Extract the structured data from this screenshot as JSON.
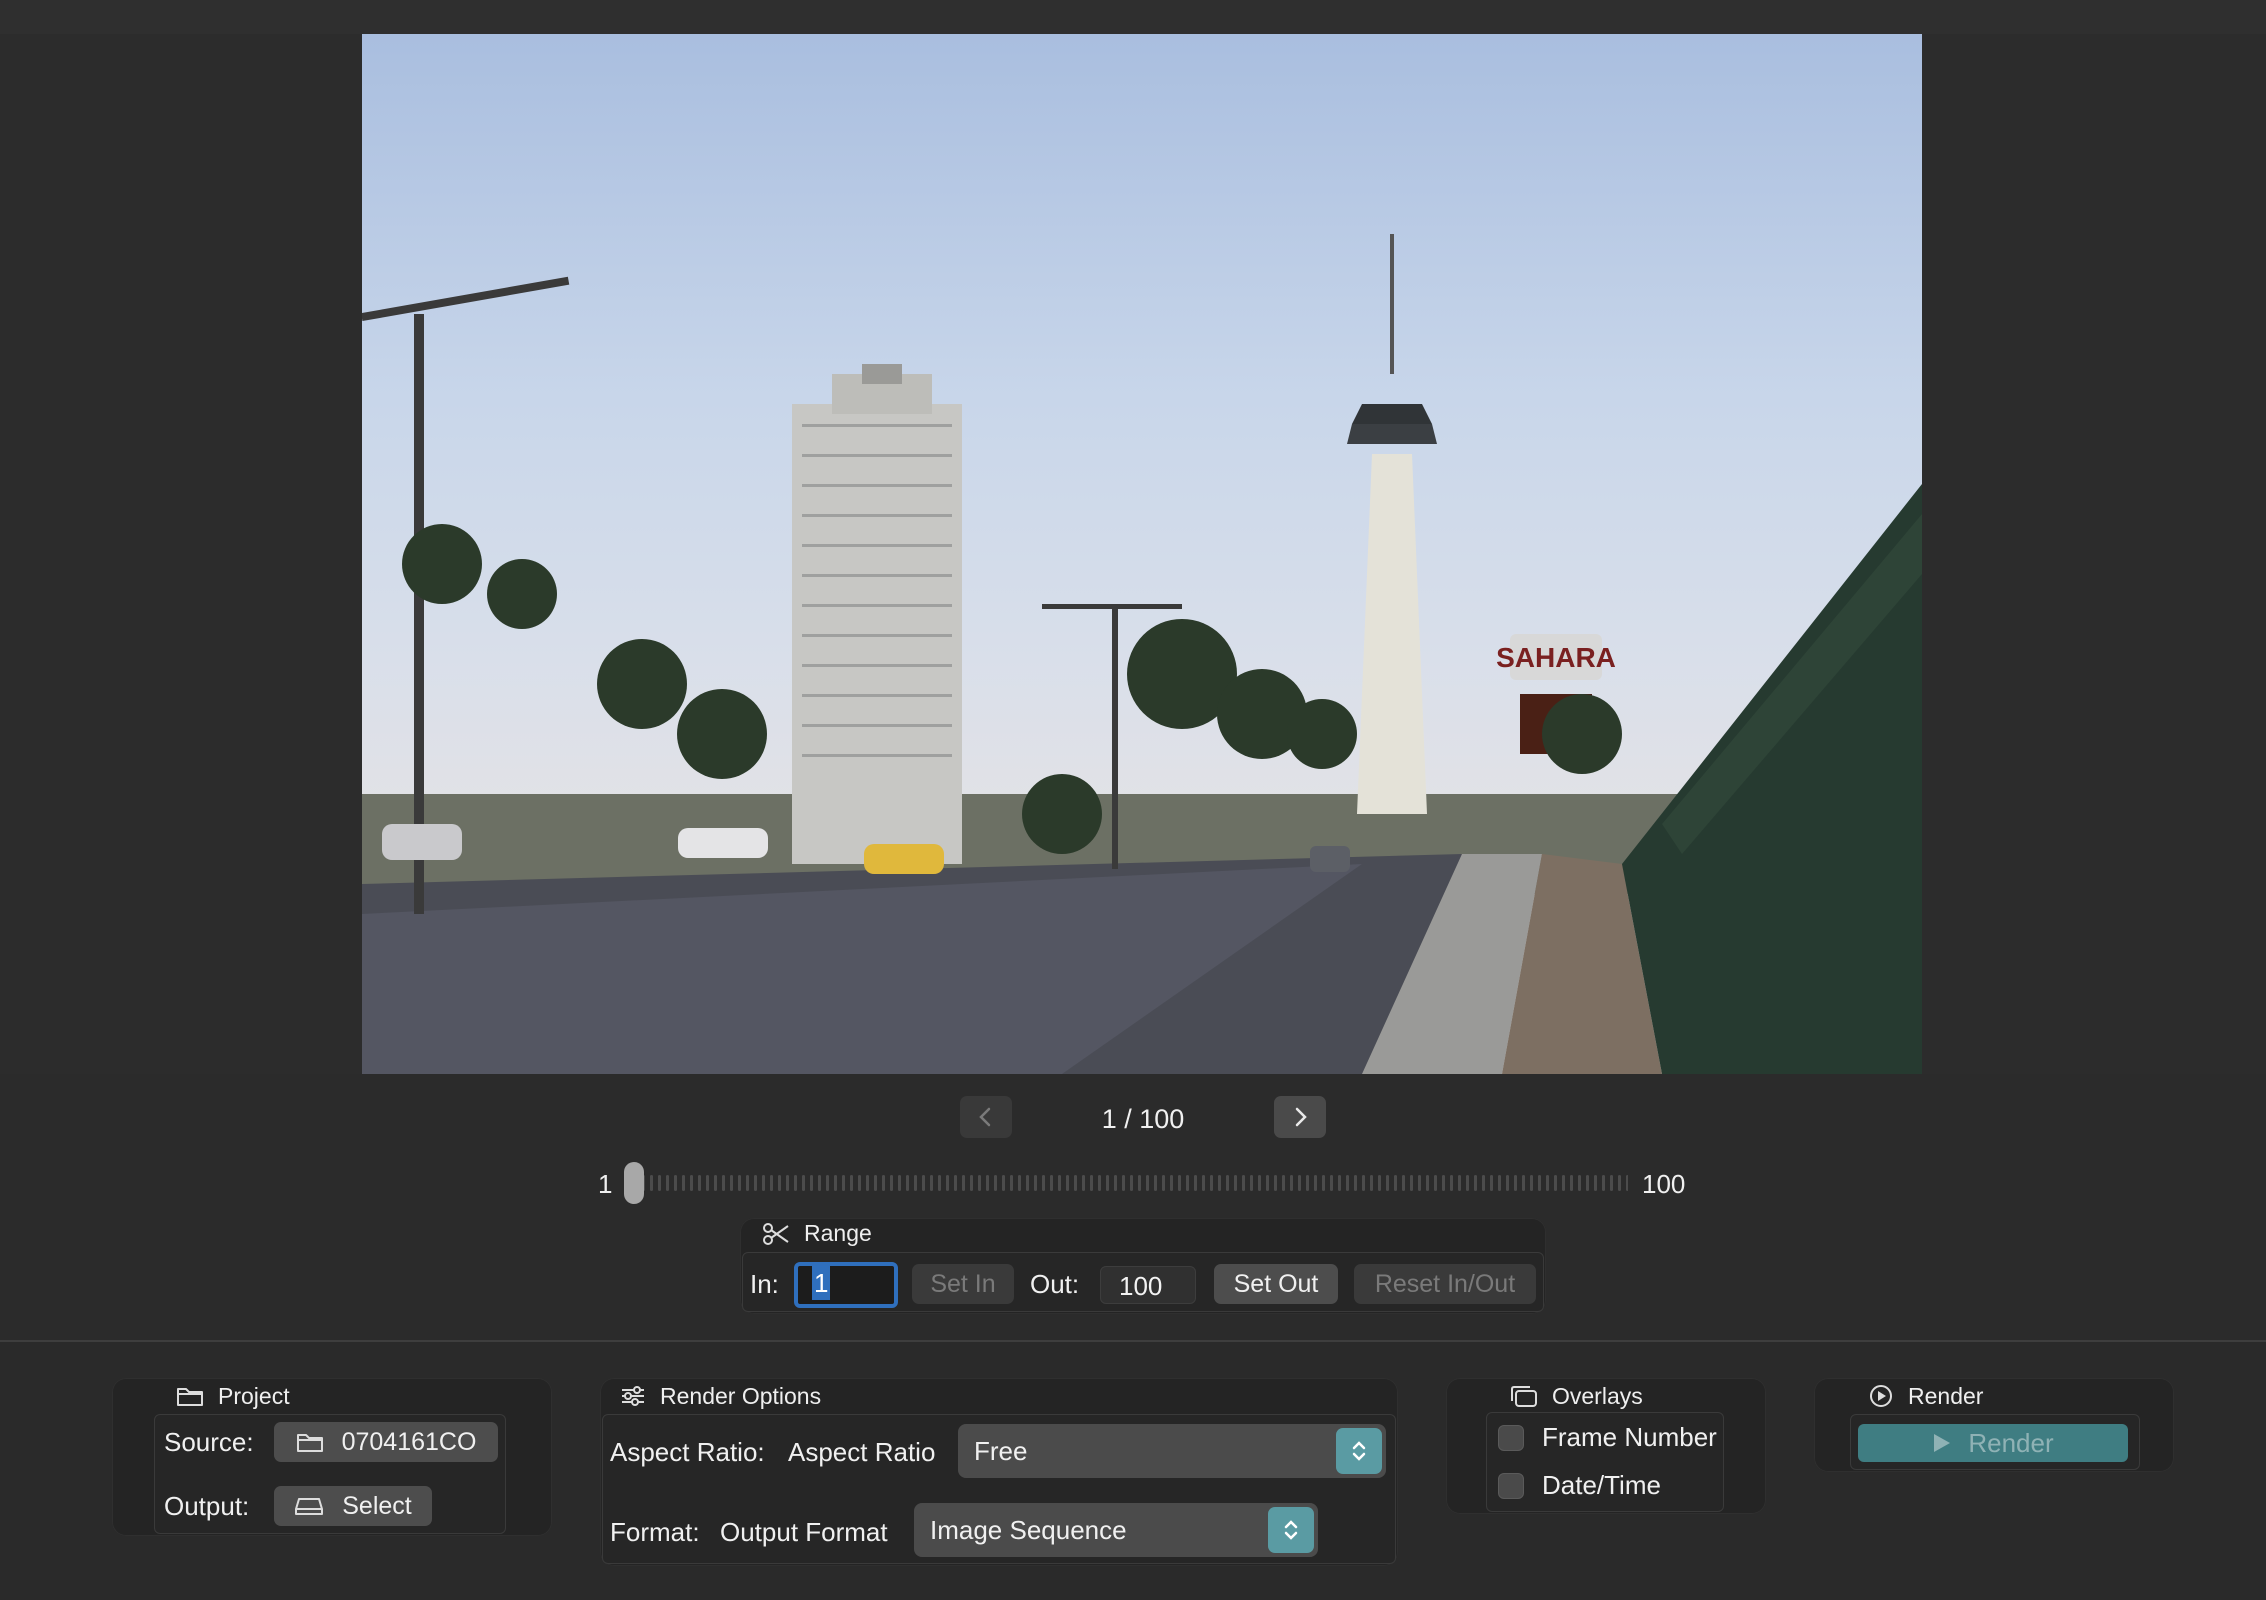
{
  "viewer": {
    "frame_counter": "1 / 100",
    "prev_icon": "chevron-left-icon",
    "next_icon": "chevron-right-icon"
  },
  "scrubber": {
    "min_label": "1",
    "max_label": "100",
    "current_frame": 1,
    "total_frames": 100
  },
  "range": {
    "title": "Range",
    "icon": "scissors-icon",
    "in_label": "In:",
    "in_value": "1",
    "set_in_label": "Set In",
    "out_label": "Out:",
    "out_value": "100",
    "set_out_label": "Set Out",
    "reset_label": "Reset In/Out"
  },
  "project": {
    "title": "Project",
    "icon": "folder-icon",
    "source_label": "Source:",
    "source_value": "0704161CO",
    "output_label": "Output:",
    "output_button": "Select"
  },
  "render_options": {
    "title": "Render Options",
    "icon": "sliders-icon",
    "aspect_label": "Aspect Ratio:",
    "aspect_sublabel": "Aspect Ratio",
    "aspect_value": "Free",
    "format_label": "Format:",
    "format_sublabel": "Output Format",
    "format_value": "Image Sequence"
  },
  "overlays": {
    "title": "Overlays",
    "icon": "overlays-icon",
    "frame_number_label": "Frame Number",
    "date_time_label": "Date/Time",
    "frame_number_checked": false,
    "date_time_checked": false
  },
  "render": {
    "title": "Render",
    "icon": "play-circle-icon",
    "button_label": "Render"
  },
  "colors": {
    "accent": "#2f6fbd",
    "render_teal": "#3f7d82",
    "stepper_teal": "#5a9ba3",
    "background": "#2a2a2a"
  }
}
